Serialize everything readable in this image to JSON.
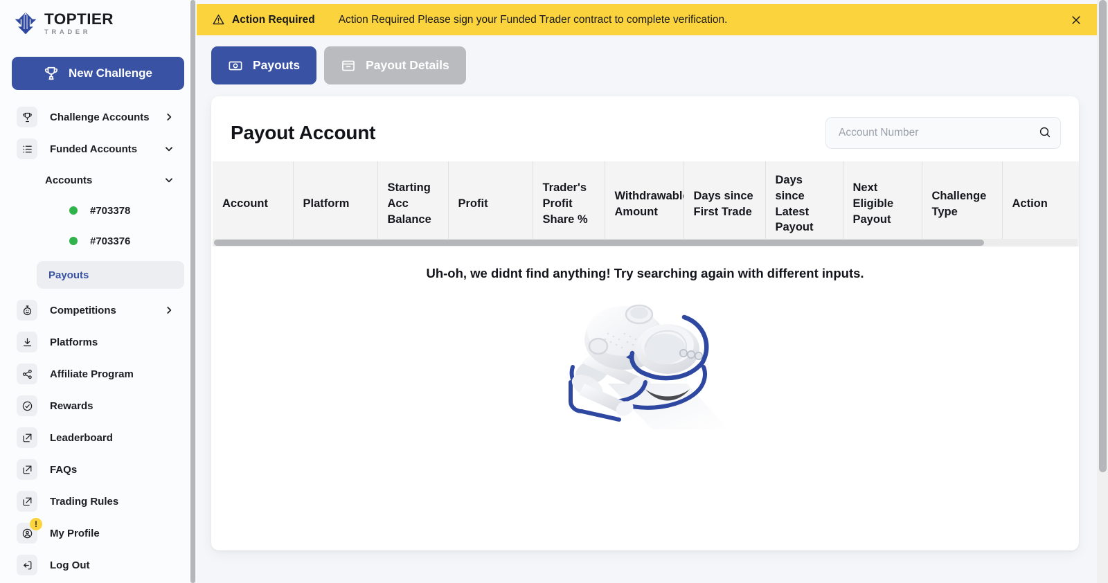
{
  "brand": {
    "name_top": "TOPTIER",
    "name_sub": "TRADER",
    "logo_icon": "toptier-logo-icon",
    "primary_color": "#3A52A4",
    "accent_yellow": "#FBD43D",
    "status_green": "#2FB34A"
  },
  "sidebar": {
    "new_challenge_label": "New Challenge",
    "new_challenge_icon": "trophy-icon",
    "items": [
      {
        "label": "Challenge Accounts",
        "icon": "trophy-icon",
        "chevron": "chevron-right-icon"
      },
      {
        "label": "Funded Accounts",
        "icon": "list-icon",
        "chevron": "chevron-down-icon"
      }
    ],
    "sub_group": {
      "label": "Accounts",
      "chevron": "chevron-down-icon"
    },
    "accounts": [
      {
        "label": "#703378",
        "status": "online"
      },
      {
        "label": "#703376",
        "status": "online"
      }
    ],
    "payouts": {
      "label": "Payouts",
      "active": true
    },
    "bottom_items": [
      {
        "label": "Competitions",
        "icon": "stopwatch-icon",
        "chevron": "chevron-right-icon"
      },
      {
        "label": "Platforms",
        "icon": "download-icon",
        "chevron": ""
      },
      {
        "label": "Affiliate Program",
        "icon": "share-icon",
        "chevron": ""
      },
      {
        "label": "Rewards",
        "icon": "check-circle-icon",
        "chevron": ""
      },
      {
        "label": "Leaderboard",
        "icon": "external-link-icon",
        "chevron": ""
      },
      {
        "label": "FAQs",
        "icon": "external-link-icon",
        "chevron": ""
      },
      {
        "label": "Trading Rules",
        "icon": "external-link-icon",
        "chevron": ""
      },
      {
        "label": "My Profile",
        "icon": "user-circle-icon",
        "chevron": "",
        "badge": "!"
      },
      {
        "label": "Log Out",
        "icon": "logout-icon",
        "chevron": ""
      }
    ]
  },
  "banner": {
    "icon": "warning-triangle-icon",
    "title": "Action Required",
    "message": "Action Required Please sign your Funded Trader contract to complete verification.",
    "close_icon": "close-icon",
    "background": "#FBD43D"
  },
  "tabs": [
    {
      "label": "Payouts",
      "icon": "payout-money-icon",
      "active": true
    },
    {
      "label": "Payout Details",
      "icon": "archive-box-icon",
      "active": false
    }
  ],
  "main": {
    "page_title": "Payout Account",
    "search": {
      "placeholder": "Account Number",
      "value": "",
      "icon": "search-icon"
    },
    "table": {
      "columns": [
        "Account",
        "Platform",
        "Starting Acc Balance",
        "Profit",
        "Trader's Profit Share %",
        "Withdrawable Amount",
        "Days since First Trade",
        "Days since Latest Payout",
        "Next Eligible Payout",
        "Challenge Type",
        "Action"
      ],
      "rows": []
    },
    "empty_state": {
      "message": "Uh-oh, we didnt find anything! Try searching again with different inputs.",
      "illustration": "submarine-illustration"
    }
  },
  "scrollbars": {
    "sidebar_vertical": "sidebar-scrollbar",
    "table_horizontal": "table-horizontal-scrollbar",
    "page_vertical": "page-scrollbar"
  }
}
